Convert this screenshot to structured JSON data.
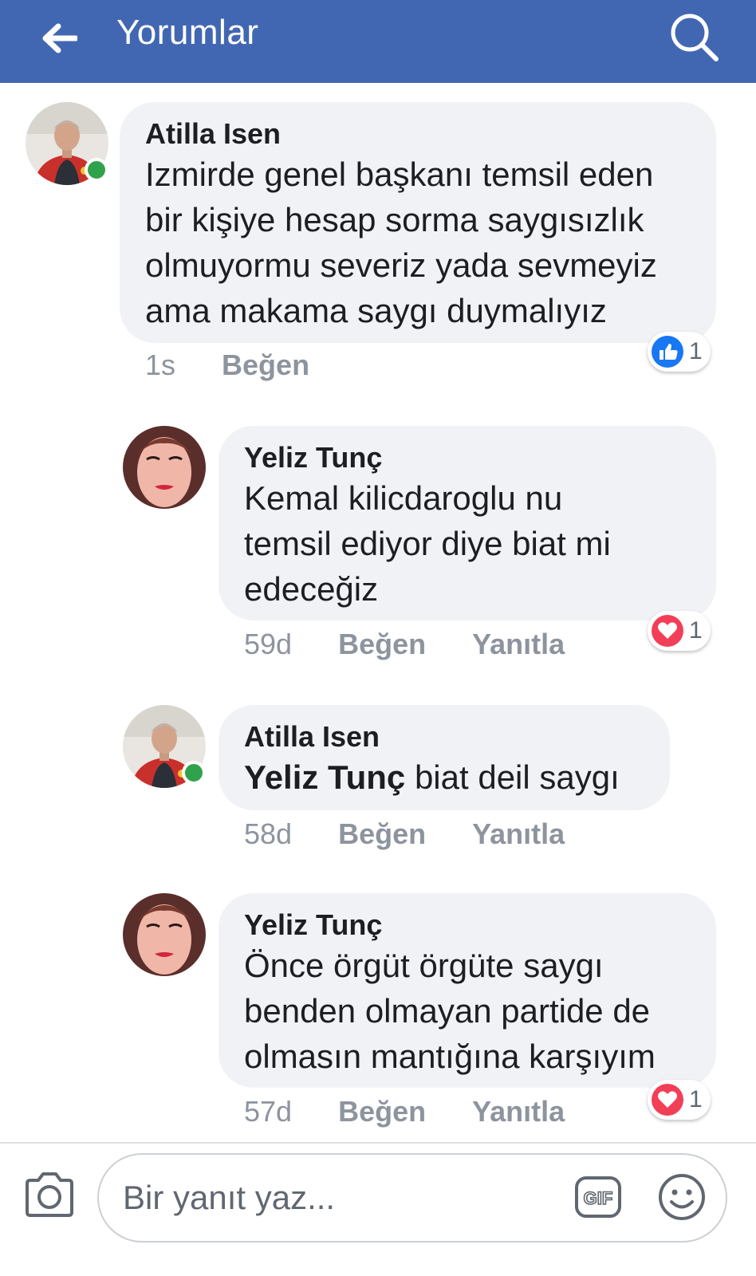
{
  "header": {
    "title": "Yorumlar",
    "back_icon": "back-arrow-icon",
    "search_icon": "search-icon",
    "background": "#4267b2"
  },
  "comments": [
    {
      "author": "Atilla Isen",
      "lines": [
        "Izmirde genel başkanı temsil eden",
        "bir kişiye hesap sorma  saygısızlık",
        "olmuyormu severiz yada sevmeyiz",
        "ama makama saygı duymalıyız"
      ],
      "time": "1s",
      "like_label": "Beğen",
      "reaction": {
        "type": "like",
        "count": "1"
      },
      "online": true
    },
    {
      "author": "Yeliz Tunç",
      "lines": [
        "Kemal kilicdaroglu nu",
        "temsil ediyor diye biat mi",
        "edeceğiz"
      ],
      "time": "59d",
      "like_label": "Beğen",
      "reply_label": "Yanıtla",
      "reaction": {
        "type": "love",
        "count": "1"
      }
    },
    {
      "author": "Atilla Isen",
      "mention": "Yeliz Tunç",
      "text": " biat deil saygı",
      "time": "58d",
      "like_label": "Beğen",
      "reply_label": "Yanıtla",
      "online": true
    },
    {
      "author": "Yeliz Tunç",
      "lines": [
        "Önce örgüt örgüte saygı",
        "benden olmayan partide de",
        "olmasın mantığına karşıyım"
      ],
      "time": "57d",
      "like_label": "Beğen",
      "reply_label": "Yanıtla",
      "reaction": {
        "type": "love",
        "count": "1"
      }
    }
  ],
  "composer": {
    "placeholder": "Bir yanıt yaz...",
    "camera_icon": "camera-icon",
    "gif_icon": "gif-icon",
    "emoji_icon": "emoji-icon"
  },
  "colors": {
    "accent": "#4267b2",
    "like_blue": "#1877f2",
    "love_red": "#f33e58",
    "online_green": "#31a24c",
    "bubble": "#f1f2f5"
  }
}
